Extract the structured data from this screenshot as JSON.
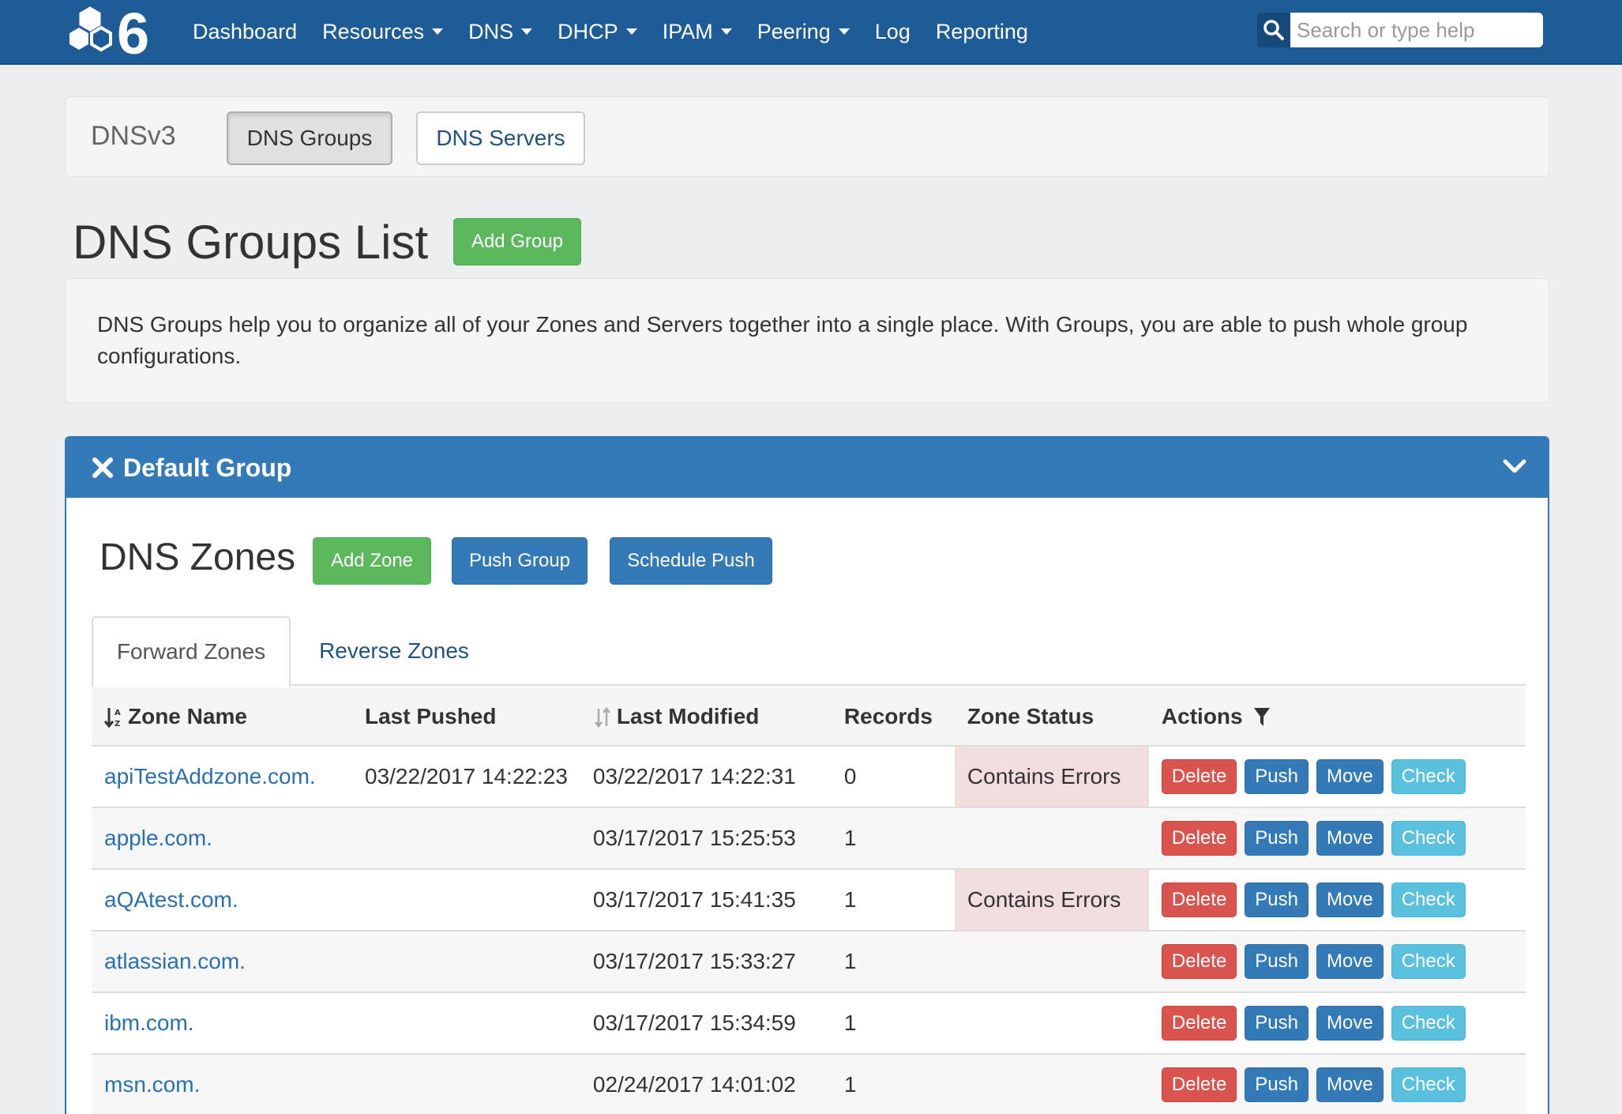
{
  "nav": {
    "items": [
      {
        "label": "Dashboard",
        "dropdown": false
      },
      {
        "label": "Resources",
        "dropdown": true
      },
      {
        "label": "DNS",
        "dropdown": true
      },
      {
        "label": "DHCP",
        "dropdown": true
      },
      {
        "label": "IPAM",
        "dropdown": true
      },
      {
        "label": "Peering",
        "dropdown": true
      },
      {
        "label": "Log",
        "dropdown": false
      },
      {
        "label": "Reporting",
        "dropdown": false
      }
    ],
    "search_placeholder": "Search or type help"
  },
  "subnav": {
    "title": "DNSv3",
    "tab_groups": "DNS Groups",
    "tab_servers": "DNS Servers"
  },
  "page": {
    "title": "DNS Groups List",
    "add_group": "Add Group",
    "description": "DNS Groups help you to organize all of your Zones and Servers together into a single place. With Groups, you are able to push whole group configurations."
  },
  "group": {
    "name": "Default Group",
    "zones_title": "DNS Zones",
    "add_zone": "Add Zone",
    "push_group": "Push Group",
    "schedule_push": "Schedule Push",
    "tabs": [
      "Forward Zones",
      "Reverse Zones"
    ],
    "columns": [
      "Zone Name",
      "Last Pushed",
      "Last Modified",
      "Records",
      "Zone Status",
      "Actions"
    ],
    "actions": {
      "delete": "Delete",
      "push": "Push",
      "move": "Move",
      "check": "Check"
    },
    "rows": [
      {
        "zone": "apiTestAddzone.com.",
        "last_pushed": "03/22/2017 14:22:23",
        "last_modified": "03/22/2017 14:22:31",
        "records": "0",
        "status": "Contains Errors"
      },
      {
        "zone": "apple.com.",
        "last_pushed": "",
        "last_modified": "03/17/2017 15:25:53",
        "records": "1",
        "status": ""
      },
      {
        "zone": "aQAtest.com.",
        "last_pushed": "",
        "last_modified": "03/17/2017 15:41:35",
        "records": "1",
        "status": "Contains Errors"
      },
      {
        "zone": "atlassian.com.",
        "last_pushed": "",
        "last_modified": "03/17/2017 15:33:27",
        "records": "1",
        "status": ""
      },
      {
        "zone": "ibm.com.",
        "last_pushed": "",
        "last_modified": "03/17/2017 15:34:59",
        "records": "1",
        "status": ""
      },
      {
        "zone": "msn.com.",
        "last_pushed": "",
        "last_modified": "02/24/2017 14:01:02",
        "records": "1",
        "status": ""
      }
    ]
  },
  "colors": {
    "navbar": "#1e5c97",
    "primary": "#337ab7",
    "success": "#5cb85c",
    "danger": "#d9534f",
    "info": "#5bc0de",
    "error_cell": "#f2dede"
  }
}
